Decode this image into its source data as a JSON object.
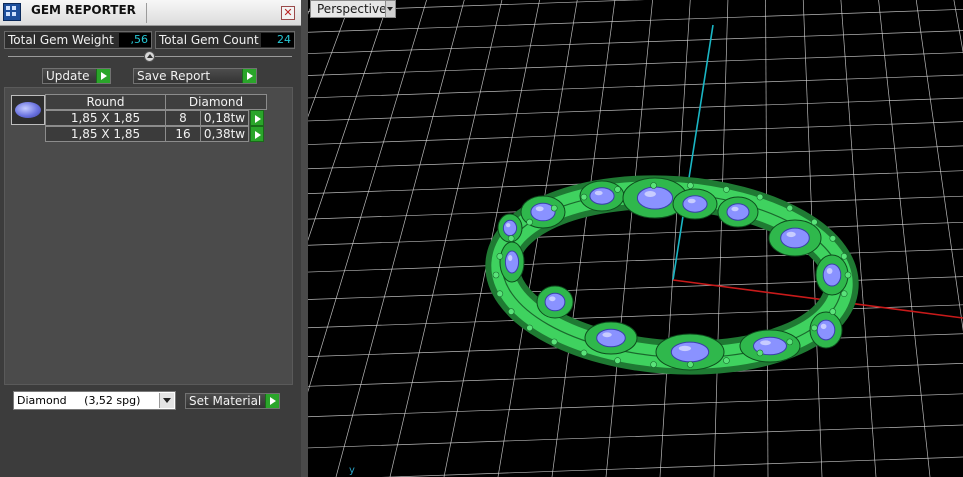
{
  "window": {
    "title": "GEM REPORTER",
    "close_glyph": "✕"
  },
  "stats": {
    "weight_label": "Total Gem Weight",
    "weight_value": ",56",
    "count_label": "Total Gem Count",
    "count_value": "24"
  },
  "actions": {
    "update_label": "Update",
    "save_label": "Save Report"
  },
  "table": {
    "headers": [
      "Round",
      "Diamond"
    ],
    "rows": [
      {
        "size": "1,85 X 1,85",
        "count": "8",
        "weight": "0,18tw"
      },
      {
        "size": "1,85 X 1,85",
        "count": "16",
        "weight": "0,38tw"
      }
    ]
  },
  "material": {
    "selected": "Diamond     (3,52 spg)",
    "set_label": "Set Material"
  },
  "viewport": {
    "mode_label": "Perspective",
    "axis_label": "y",
    "colors": {
      "grid": "#d9d9d9",
      "axis_y": "#1ab6c4",
      "axis_x": "#c81a1a",
      "metal": "#3fd25f",
      "gem": "#8a92ff"
    }
  },
  "icons": {
    "app": "gem-reporter-icon",
    "close": "close-icon",
    "update": "play-icon",
    "save": "play-icon",
    "row_action": "play-icon",
    "select_arrow": "chevron-down-icon",
    "set_material": "play-icon",
    "viewport_menu": "chevron-down-icon"
  }
}
